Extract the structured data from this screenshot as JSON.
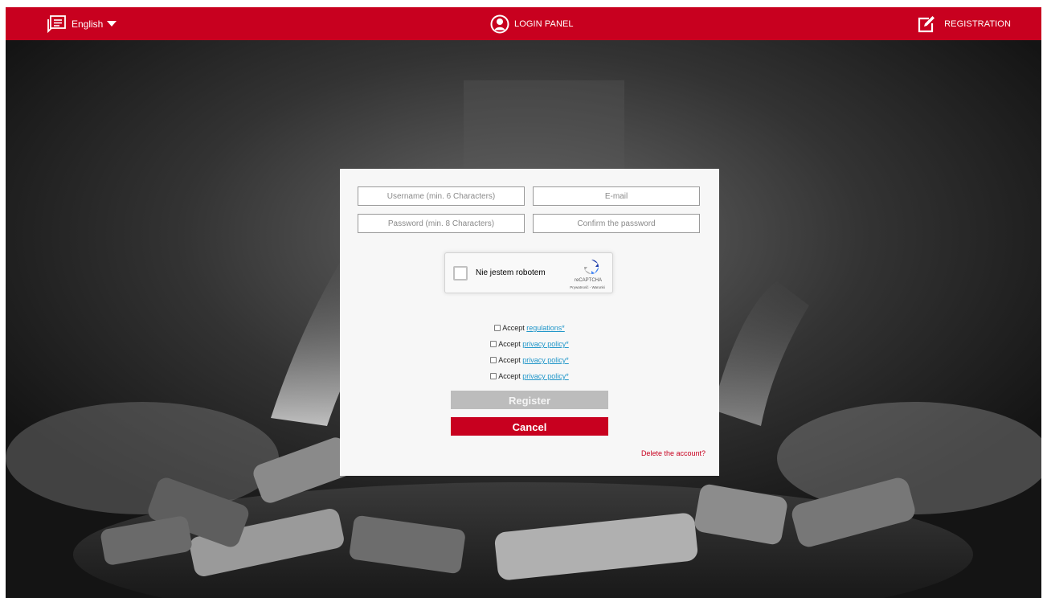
{
  "colors": {
    "brand_red": "#c8001f",
    "link_blue": "#2196c9",
    "register_disabled": "#bcbcbc",
    "card_bg": "#f7f7f7"
  },
  "topbar": {
    "language_label": "English",
    "language_icon": "chat-list-icon",
    "login_label": "LOGIN PANEL",
    "login_icon": "user-circle-icon",
    "registration_label": "REGISTRATION",
    "registration_icon": "edit-icon"
  },
  "form": {
    "username_placeholder": "Username (min. 6 Characters)",
    "email_placeholder": "E-mail",
    "password_placeholder": "Password (min. 8 Characters)",
    "confirm_placeholder": "Confirm the password",
    "recaptcha": {
      "label": "Nie jestem robotem",
      "brand": "reCAPTCHA",
      "links": "Prywatność - Warunki"
    },
    "accepts": [
      {
        "prefix": "Accept",
        "link": "regulations*"
      },
      {
        "prefix": "Accept",
        "link": "privacy policy*"
      },
      {
        "prefix": "Accept",
        "link": "privacy policy*"
      },
      {
        "prefix": "Accept",
        "link": "privacy policy*"
      }
    ],
    "register_label": "Register",
    "cancel_label": "Cancel",
    "delete_account_label": "Delete the account?"
  }
}
